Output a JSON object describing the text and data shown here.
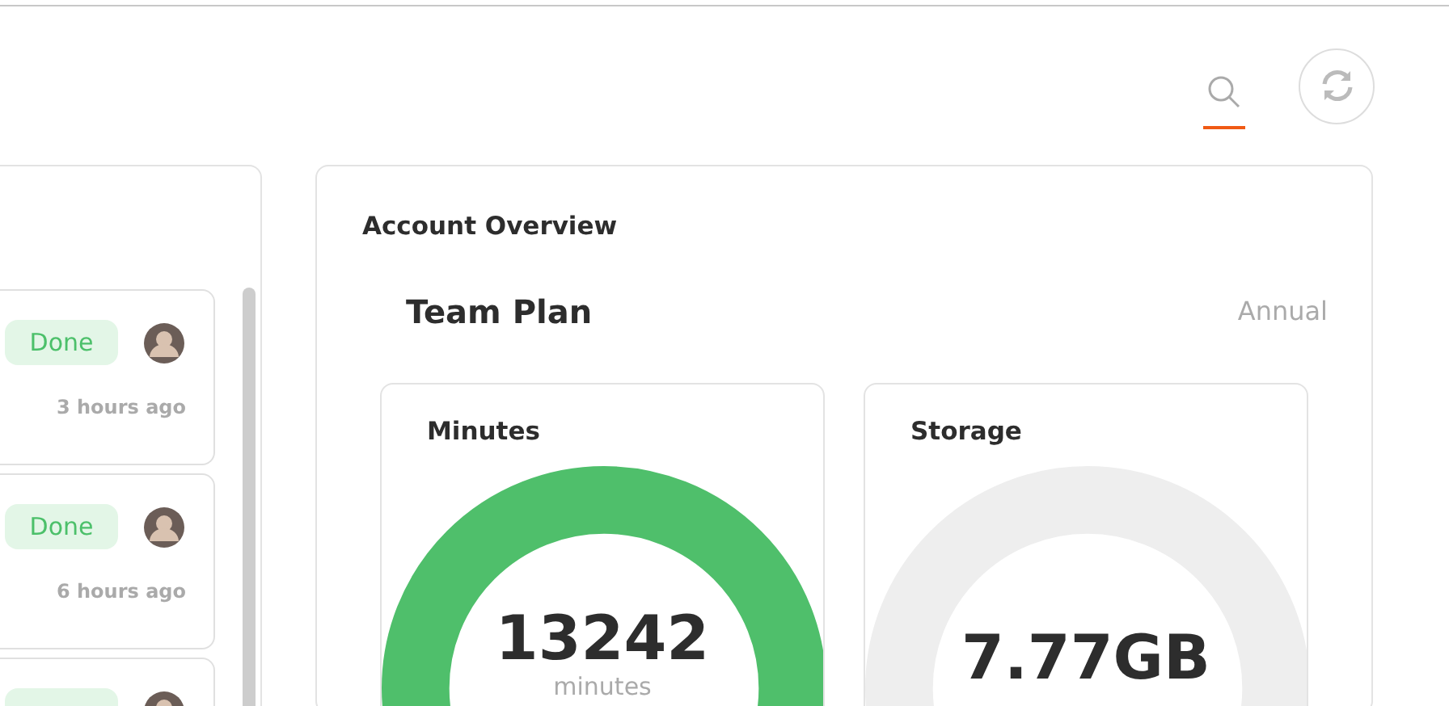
{
  "search": {
    "selected": true
  },
  "activity": [
    {
      "kind": "full",
      "status": "Done",
      "time": "3 hours ago"
    },
    {
      "kind": "full",
      "status": "Done",
      "time": "6 hours ago"
    },
    {
      "kind": "cut"
    }
  ],
  "account_overview": {
    "title": "Account Overview",
    "plan": "Team Plan",
    "billing": "Annual",
    "meters": [
      {
        "title": "Minutes",
        "value": "13242",
        "unit": "minutes",
        "kind": "filled"
      },
      {
        "title": "Storage",
        "value": "7.77GB",
        "kind": "empty"
      }
    ]
  }
}
